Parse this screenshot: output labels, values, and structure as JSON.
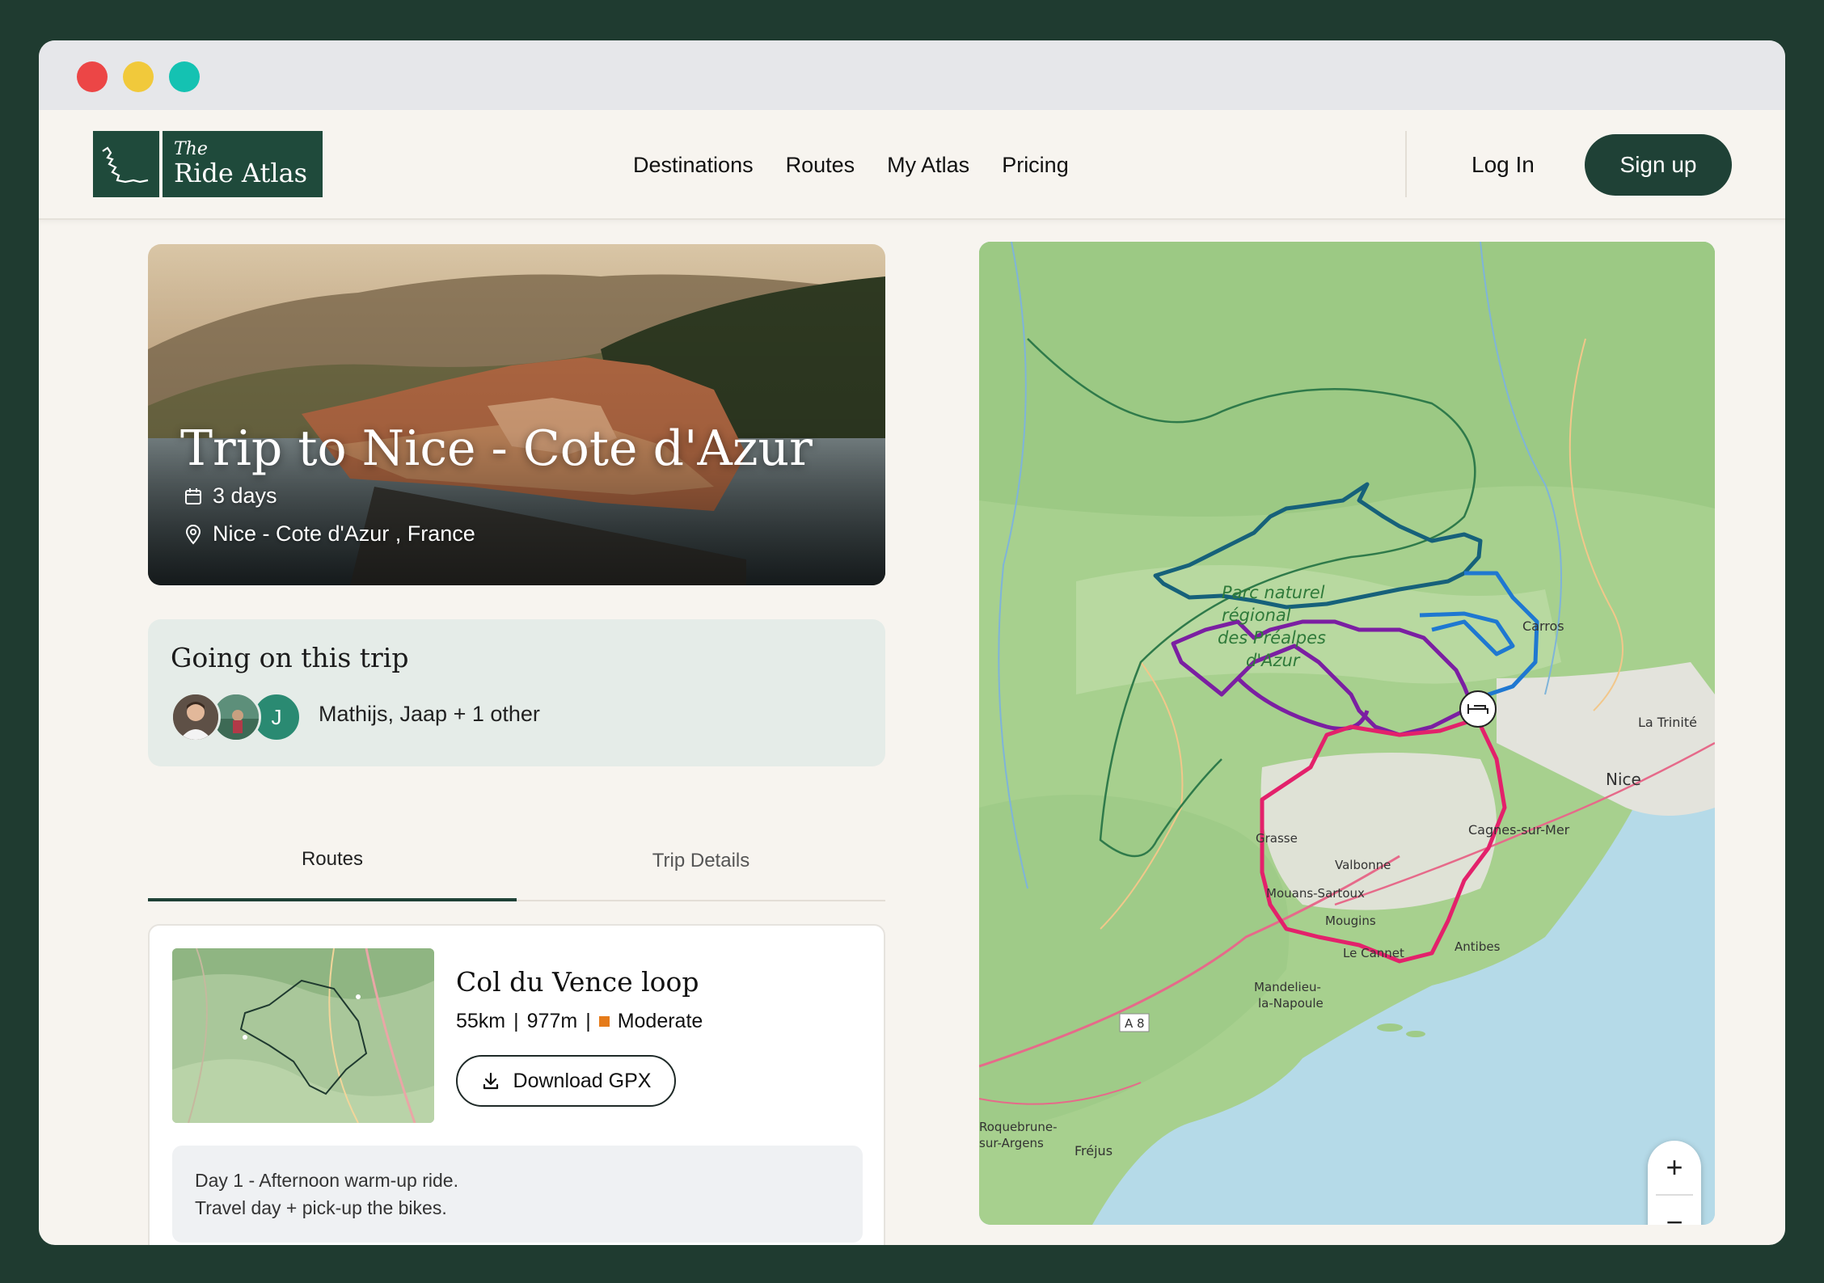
{
  "window": {
    "controls": [
      "close",
      "minimize",
      "zoom"
    ]
  },
  "brand": {
    "the": "The",
    "name": "Ride Atlas"
  },
  "nav": {
    "links": [
      "Destinations",
      "Routes",
      "My Atlas",
      "Pricing"
    ],
    "login": "Log In",
    "signup": "Sign up"
  },
  "trip": {
    "title": "Trip to Nice - Cote d'Azur",
    "duration": "3 days",
    "location": "Nice - Cote d'Azur , France"
  },
  "going": {
    "title": "Going on this trip",
    "avatar_initial": "J",
    "names": "Mathijs, Jaap + 1 other"
  },
  "tabs": [
    "Routes",
    "Trip Details"
  ],
  "route": {
    "title": "Col du Vence loop",
    "distance": "55km",
    "elevation": "977m",
    "difficulty": "Moderate",
    "difficulty_color": "#e57b1a",
    "download": "Download GPX",
    "note_line1": "Day 1 - Afternoon warm-up ride.",
    "note_line2": "Travel day + pick-up the bikes."
  },
  "map": {
    "labels": {
      "parc1": "Parc naturel",
      "parc2": "régional",
      "parc3": "des Préalpes",
      "parc4": "d'Azur",
      "carros": "Carros",
      "trinite": "La Trinité",
      "nice": "Nice",
      "cagnes": "Cagnes-sur-Mer",
      "grasse": "Grasse",
      "valbonne": "Valbonne",
      "mouans": "Mouans-Sartoux",
      "mougins": "Mougins",
      "cannet": "Le Cannet",
      "antibes": "Antibes",
      "mandelieu1": "Mandelieu-",
      "mandelieu2": "la-Napoule",
      "a8": "A 8",
      "roquebrune1": "Roquebrune-",
      "roquebrune2": "sur-Argens",
      "frejus": "Fréjus"
    },
    "route_colors": {
      "teal": "#16617a",
      "blue": "#1f78d1",
      "purple": "#7b1fa2",
      "pink": "#e3216b"
    },
    "zoom_in": "+",
    "zoom_out": "−"
  }
}
